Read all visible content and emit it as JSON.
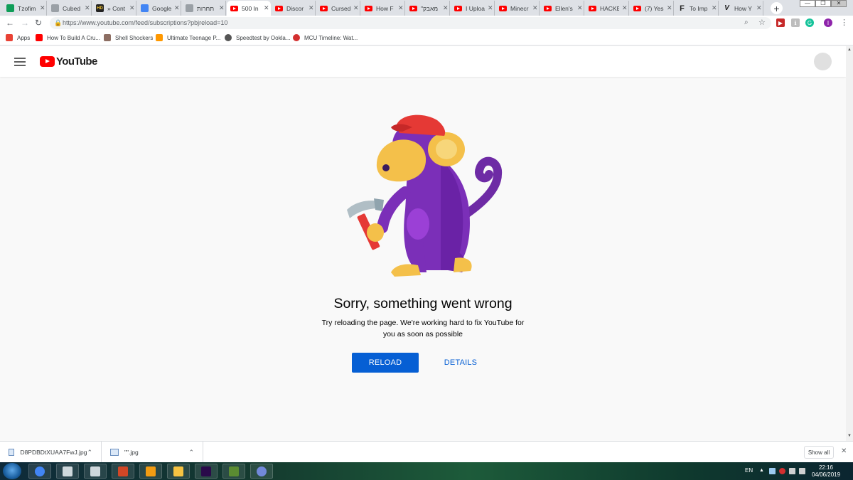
{
  "browser": {
    "tabs": [
      {
        "title": "Tzofim",
        "favicon": "sheets-icon",
        "color": "#0f9d58"
      },
      {
        "title": "Cubed",
        "favicon": "cube-icon",
        "color": "#9aa0a6"
      },
      {
        "title": "» Cont",
        "favicon": "hd-icon",
        "color": "#222222"
      },
      {
        "title": "Google",
        "favicon": "google-docs-icon",
        "color": "#4285f4"
      },
      {
        "title": "תחרות",
        "favicon": "form-icon",
        "color": "#9aa0a6"
      },
      {
        "title": "500 In",
        "favicon": "youtube-icon",
        "color": "#ff0000",
        "active": true
      },
      {
        "title": "Discor",
        "favicon": "youtube-icon",
        "color": "#ff0000"
      },
      {
        "title": "Cursed",
        "favicon": "youtube-icon",
        "color": "#ff0000"
      },
      {
        "title": "How F",
        "favicon": "youtube-icon",
        "color": "#ff0000"
      },
      {
        "title": "\"מאבק",
        "favicon": "youtube-icon",
        "color": "#ff0000"
      },
      {
        "title": "I Uploa",
        "favicon": "youtube-icon",
        "color": "#ff0000"
      },
      {
        "title": "Minecr",
        "favicon": "youtube-icon",
        "color": "#ff0000"
      },
      {
        "title": "Ellen's",
        "favicon": "youtube-icon",
        "color": "#ff0000"
      },
      {
        "title": "HACKE",
        "favicon": "youtube-icon",
        "color": "#ff0000"
      },
      {
        "title": "(7) Yes",
        "favicon": "youtube-icon",
        "color": "#ff0000"
      },
      {
        "title": "To Imp",
        "favicon": "f-icon",
        "color": "#222222"
      },
      {
        "title": "How Y",
        "favicon": "v-icon",
        "color": "#222222"
      }
    ],
    "tab_close_glyph": "✕",
    "new_tab_glyph": "+",
    "url": "https://www.youtube.com/feed/subscriptions?pbjreload=10",
    "bookmarks": [
      {
        "label": "Apps",
        "icon": "apps-grid-icon",
        "color": "#e94235"
      },
      {
        "label": "How To Build A Cru...",
        "icon": "youtube-icon",
        "color": "#ff0000"
      },
      {
        "label": "Shell Shockers",
        "icon": "egg-icon",
        "color": "#8d6e63"
      },
      {
        "label": "Ultimate Teenage P...",
        "icon": "pumpkin-icon",
        "color": "#ff9800"
      },
      {
        "label": "Speedtest by Ookla...",
        "icon": "speedometer-icon",
        "color": "#555555"
      },
      {
        "label": "MCU Timeline: Wat...",
        "icon": "reddit-icon",
        "color": "#d32f2f"
      }
    ]
  },
  "youtube": {
    "logo_text": "YouTube",
    "error": {
      "title": "Sorry, something went wrong",
      "message": "Try reloading the page. We're working hard to fix YouTube for you as soon as possible",
      "reload_label": "RELOAD",
      "details_label": "DETAILS"
    },
    "colors": {
      "accent": "#065fd4",
      "brand": "#ff0000"
    }
  },
  "downloads": {
    "items": [
      {
        "filename": "D8PDBDtXUAA7FwJ.jpg"
      },
      {
        "filename": "\"\".jpg"
      }
    ],
    "show_all_label": "Show all"
  },
  "taskbar": {
    "apps": [
      {
        "name": "chrome-icon",
        "color": "#4285f4"
      },
      {
        "name": "notes-icon",
        "color": "#cfd8dc"
      },
      {
        "name": "calculator-icon",
        "color": "#cfd8dc"
      },
      {
        "name": "powerpoint-icon",
        "color": "#d24726"
      },
      {
        "name": "media-player-icon",
        "color": "#f39c12"
      },
      {
        "name": "file-explorer-icon",
        "color": "#f6c342"
      },
      {
        "name": "premiere-icon",
        "color": "#2a0a4a"
      },
      {
        "name": "minecraft-icon",
        "color": "#5b8c32"
      },
      {
        "name": "discord-icon",
        "color": "#7289da"
      }
    ],
    "language": "EN",
    "time": "22:16",
    "date": "04/06/2019"
  }
}
